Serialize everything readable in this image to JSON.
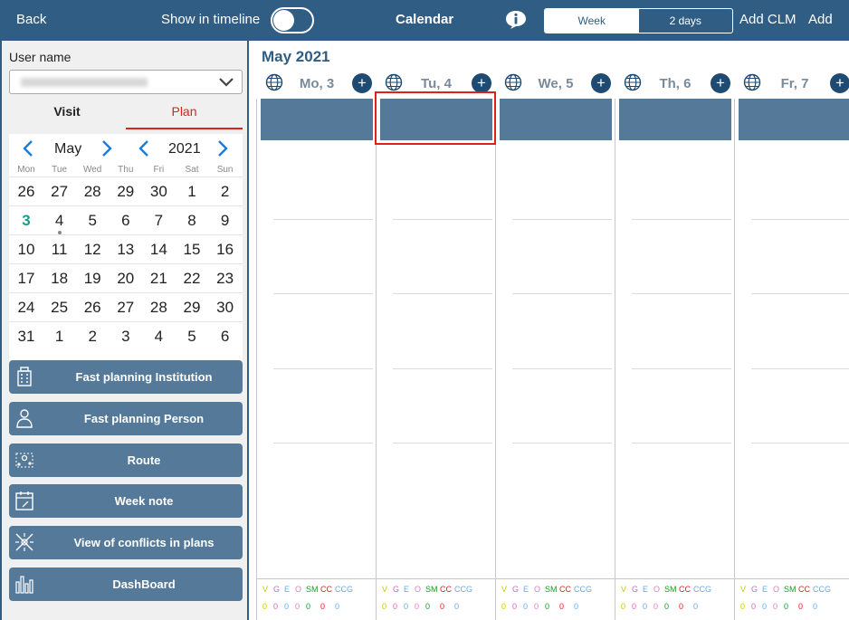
{
  "topbar": {
    "back": "Back",
    "show_in_timeline": "Show in timeline",
    "title": "Calendar",
    "views": [
      "Week",
      "2 days"
    ],
    "add_clm": "Add CLM",
    "add": "Add"
  },
  "sidebar": {
    "user_label": "User name",
    "tabs": {
      "visit": "Visit",
      "plan": "Plan"
    },
    "mini_calendar": {
      "month": "May",
      "year": "2021",
      "weekdays": [
        "Mon",
        "Tue",
        "Wed",
        "Thu",
        "Fri",
        "Sat",
        "Sun"
      ],
      "weeks": [
        [
          "26",
          "27",
          "28",
          "29",
          "30",
          "1",
          "2"
        ],
        [
          "3",
          "4",
          "5",
          "6",
          "7",
          "8",
          "9"
        ],
        [
          "10",
          "11",
          "12",
          "13",
          "14",
          "15",
          "16"
        ],
        [
          "17",
          "18",
          "19",
          "20",
          "21",
          "22",
          "23"
        ],
        [
          "24",
          "25",
          "26",
          "27",
          "28",
          "29",
          "30"
        ],
        [
          "31",
          "1",
          "2",
          "3",
          "4",
          "5",
          "6"
        ]
      ]
    },
    "buttons": [
      {
        "label": "Fast planning Institution",
        "icon": "building-icon"
      },
      {
        "label": "Fast planning Person",
        "icon": "person-icon"
      },
      {
        "label": "Route",
        "icon": "route-icon"
      },
      {
        "label": "Week note",
        "icon": "note-icon"
      },
      {
        "label": "View of conflicts in plans",
        "icon": "conflict-icon"
      },
      {
        "label": "DashBoard",
        "icon": "chart-icon"
      }
    ]
  },
  "main": {
    "month_title": "May 2021",
    "days": [
      "Mo, 3",
      "Tu, 4",
      "We, 5",
      "Th, 6",
      "Fr, 7"
    ],
    "legend_letters": [
      "V",
      "G",
      "E",
      "O",
      "SM",
      "CC",
      "CCG"
    ],
    "legend_values": [
      "0",
      "0",
      "0",
      "0",
      "0",
      "0",
      "0"
    ],
    "legend_colors": [
      "#c8c800",
      "#e060c0",
      "#6aa8e0",
      "#e080c0",
      "#1a9a2a",
      "#e0201c",
      "#6aa8e0"
    ]
  },
  "colors": {
    "primary": "#2f5d84",
    "band": "#557a99",
    "accent": "#e0201c",
    "today": "#1a9a8a"
  }
}
